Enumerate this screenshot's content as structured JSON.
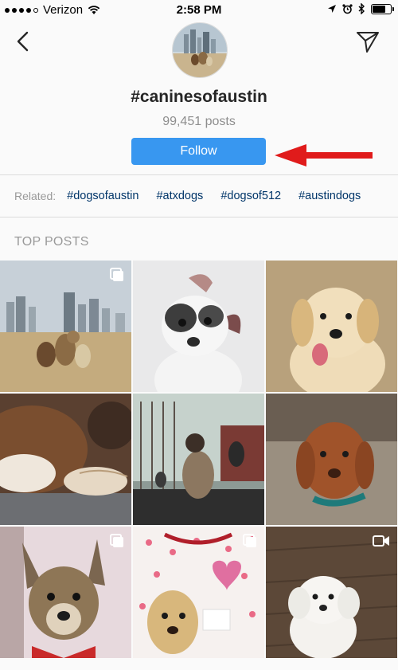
{
  "status_bar": {
    "carrier": "Verizon",
    "time": "2:58 PM",
    "battery_level": 0.8
  },
  "header": {
    "back_icon": "chevron-left-icon",
    "share_icon": "paper-plane-icon"
  },
  "hashtag": {
    "title": "#caninesofaustin",
    "posts": "99,451 posts",
    "follow_label": "Follow"
  },
  "related": {
    "label": "Related:",
    "tags": [
      "#dogsofaustin",
      "#atxdogs",
      "#dogsof512",
      "#austindogs"
    ]
  },
  "section_title": "TOP POSTS",
  "posts": [
    {
      "subject": "dogs-skyline",
      "badge": "multiple-photos-icon"
    },
    {
      "subject": "pitbull-puppy",
      "badge": ""
    },
    {
      "subject": "golden-puppy",
      "badge": ""
    },
    {
      "subject": "sleeping-boxer",
      "badge": ""
    },
    {
      "subject": "dog-and-cats-window",
      "badge": ""
    },
    {
      "subject": "wet-golden-dog",
      "badge": ""
    },
    {
      "subject": "dog-with-bandana",
      "badge": "multiple-photos-icon"
    },
    {
      "subject": "lab-valentines",
      "badge": "multiple-photos-icon"
    },
    {
      "subject": "white-poodle",
      "badge": "video-icon"
    }
  ],
  "colors": {
    "follow_button": "#3897f0",
    "hashtag_link": "#003569",
    "annotation_arrow": "#e01b1b"
  }
}
